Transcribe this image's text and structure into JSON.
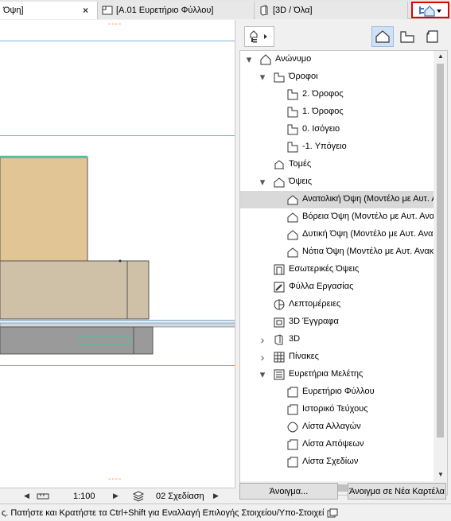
{
  "tabs": [
    {
      "label": "Όψη]",
      "close": "×"
    },
    {
      "label": "[A.01 Ευρετήριο Φύλλου]"
    },
    {
      "label": "[3D / Όλα]"
    }
  ],
  "canvas": {
    "marker_top": "----",
    "marker_bottom": "----"
  },
  "canvas_bar": {
    "scale": "1:100",
    "layer_combination": "02 Σχεδίαση"
  },
  "status": {
    "text": "ς. Πατήστε και Κρατήστε τα Ctrl+Shift για Εναλλαγή Επιλογής Στοιχείου/Υπο-Στοιχεί"
  },
  "navigator": {
    "tree": [
      {
        "label": "Ανώνυμο",
        "icon": "project-icon",
        "caret": "down"
      },
      {
        "label": "Όροφοι",
        "icon": "stories-icon",
        "caret": "down"
      },
      {
        "label": "2. Όροφος",
        "icon": "story-icon"
      },
      {
        "label": "1. Όροφος",
        "icon": "story-icon"
      },
      {
        "label": "0. Ισόγειο",
        "icon": "story-icon"
      },
      {
        "label": "-1. Υπόγειο",
        "icon": "story-icon"
      },
      {
        "label": "Τομές",
        "icon": "section-icon"
      },
      {
        "label": "Όψεις",
        "icon": "elevation-icon",
        "caret": "down"
      },
      {
        "label": "Ανατολική Όψη (Μοντέλο με Αυτ. Α",
        "icon": "elevation-icon",
        "selected": true
      },
      {
        "label": "Βόρεια Όψη (Μοντέλο με Αυτ. Ανα",
        "icon": "elevation-icon"
      },
      {
        "label": "Δυτική Όψη (Μοντέλο με Αυτ. Ανα",
        "icon": "elevation-icon"
      },
      {
        "label": "Νότια Όψη (Μοντέλο με Αυτ. Ανακ",
        "icon": "elevation-icon"
      },
      {
        "label": "Εσωτερικές Όψεις",
        "icon": "interior-elevation-icon"
      },
      {
        "label": "Φύλλα Εργασίας",
        "icon": "worksheet-icon"
      },
      {
        "label": "Λεπτομέρειες",
        "icon": "detail-icon"
      },
      {
        "label": "3D Έγγραφα",
        "icon": "3d-document-icon"
      },
      {
        "label": "3D",
        "icon": "3d-icon",
        "caret": "right"
      },
      {
        "label": "Πίνακες",
        "icon": "schedule-icon",
        "caret": "right"
      },
      {
        "label": "Ευρετήρια Μελέτης",
        "icon": "index-icon",
        "caret": "down"
      },
      {
        "label": "Ευρετήριο Φύλλου",
        "icon": "sheet-index-icon"
      },
      {
        "label": "Ιστορικό Τεύχους",
        "icon": "sheet-index-icon"
      },
      {
        "label": "Λίστα Αλλαγών",
        "icon": "change-list-icon"
      },
      {
        "label": "Λίστα Απόψεων",
        "icon": "sheet-index-icon"
      },
      {
        "label": "Λίστα Σχεδίων",
        "icon": "sheet-index-icon"
      }
    ],
    "open_label": "Άνοιγμα...",
    "open_new_tab_label": "Άνοιγμα σε Νέα Καρτέλα"
  },
  "colors": {
    "accent": "#e00000",
    "selection": "#d9d9d9",
    "building_top": "#e2c594",
    "building_base": "#cfc1a8",
    "ground": "#9a9a9a",
    "roof_line": "#4fc2a2",
    "level_line": "#7fb3d9",
    "marker": "#ff8a3c"
  }
}
